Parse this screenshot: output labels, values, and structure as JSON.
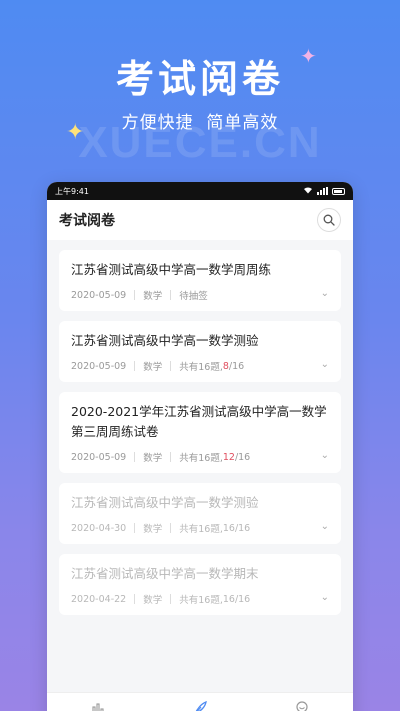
{
  "hero": {
    "title": "考试阅卷",
    "subtitle": "方便快捷  简单高效",
    "watermark": "XUECE.CN"
  },
  "status_bar": {
    "time": "上午9:41"
  },
  "app_bar": {
    "title": "考试阅卷",
    "search_icon": "search-icon"
  },
  "exams": [
    {
      "title": "江苏省测试高级中学高一数学周周练",
      "date": "2020-05-09",
      "subject": "数学",
      "status": "待抽签",
      "dim": false
    },
    {
      "title": "江苏省测试高级中学高一数学测验",
      "date": "2020-05-09",
      "subject": "数学",
      "count_label": "共有16题,",
      "done": "8",
      "total": "/16",
      "dim": false
    },
    {
      "title": "2020-2021学年江苏省测试高级中学高一数学第三周周练试卷",
      "date": "2020-05-09",
      "subject": "数学",
      "count_label": "共有16题,",
      "done": "12",
      "total": "/16",
      "dim": false
    },
    {
      "title": "江苏省测试高级中学高一数学测验",
      "date": "2020-04-30",
      "subject": "数学",
      "count_label": "共有16题,",
      "done": "16",
      "total": "/16",
      "dim": true
    },
    {
      "title": "江苏省测试高级中学高一数学期末",
      "date": "2020-04-22",
      "subject": "数学",
      "count_label": "共有16题,",
      "done": "16",
      "total": "/16",
      "dim": true
    }
  ],
  "tabs": [
    {
      "icon": "chart-icon"
    },
    {
      "icon": "feather-icon",
      "active": true
    },
    {
      "icon": "medal-icon"
    }
  ],
  "colors": {
    "accent": "#4f8bf2",
    "highlight": "#e04f5f"
  }
}
